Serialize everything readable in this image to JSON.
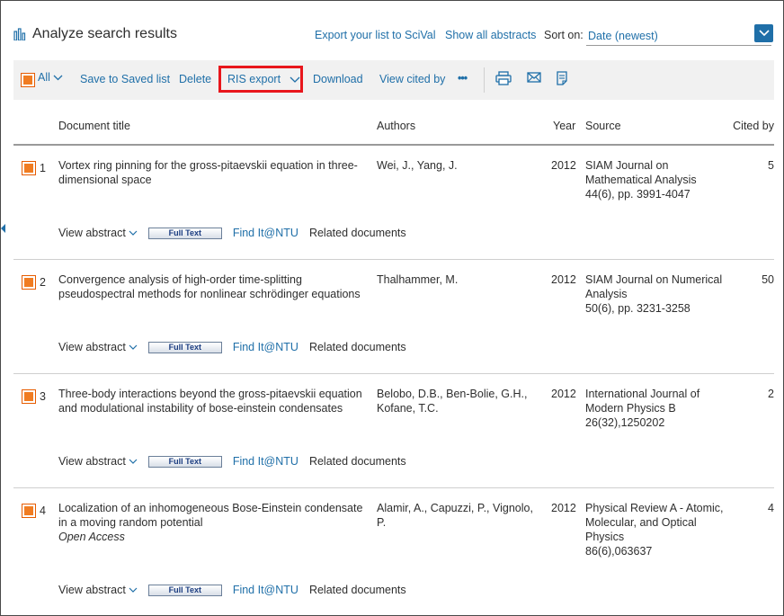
{
  "header": {
    "title": "Analyze search results",
    "export_scival": "Export your list to SciVal",
    "show_all_abstracts": "Show all abstracts",
    "sort_label": "Sort on:",
    "sort_value": "Date (newest)"
  },
  "toolbar": {
    "all_label": "All",
    "save_label": "Save to Saved list",
    "delete_label": "Delete",
    "ris_export_label": "RIS export",
    "download_label": "Download",
    "view_cited_label": "View cited by",
    "more_label": "•••"
  },
  "columns": {
    "title": "Document title",
    "authors": "Authors",
    "year": "Year",
    "source": "Source",
    "cited": "Cited by"
  },
  "row_actions": {
    "view_abstract": "View abstract",
    "full_text": "Full Text",
    "find_it": "Find It@NTU",
    "related": "Related documents"
  },
  "rows": [
    {
      "num": "1",
      "title": "Vortex ring pinning for the gross-pitaevskii equation in three-dimensional space",
      "open_access": "",
      "authors": "Wei, J., Yang, J.",
      "year": "2012",
      "source": "SIAM Journal on Mathematical Analysis",
      "source_detail": "44(6), pp. 3991-4047",
      "cited": "5"
    },
    {
      "num": "2",
      "title": "Convergence analysis of high-order time-splitting pseudospectral methods for nonlinear schrödinger equations",
      "open_access": "",
      "authors": "Thalhammer, M.",
      "year": "2012",
      "source": "SIAM Journal on Numerical Analysis",
      "source_detail": "50(6), pp. 3231-3258",
      "cited": "50"
    },
    {
      "num": "3",
      "title": "Three-body interactions beyond the gross-pitaevskii equation and modulational instability of bose-einstein condensates",
      "open_access": "",
      "authors": "Belobo, D.B., Ben-Bolie, G.H., Kofane, T.C.",
      "year": "2012",
      "source": "International Journal of Modern Physics B",
      "source_detail": "26(32),1250202",
      "cited": "2"
    },
    {
      "num": "4",
      "title": "Localization of an inhomogeneous Bose-Einstein condensate in a moving random potential",
      "open_access": "Open Access",
      "authors": "Alamir, A., Capuzzi, P., Vignolo, P.",
      "year": "2012",
      "source": "Physical Review A - Atomic, Molecular, and Optical Physics",
      "source_detail": "86(6),063637",
      "cited": "4"
    }
  ],
  "colors": {
    "link": "#1f6fa8",
    "checkbox": "#f07c22",
    "highlight": "#e8161c"
  }
}
